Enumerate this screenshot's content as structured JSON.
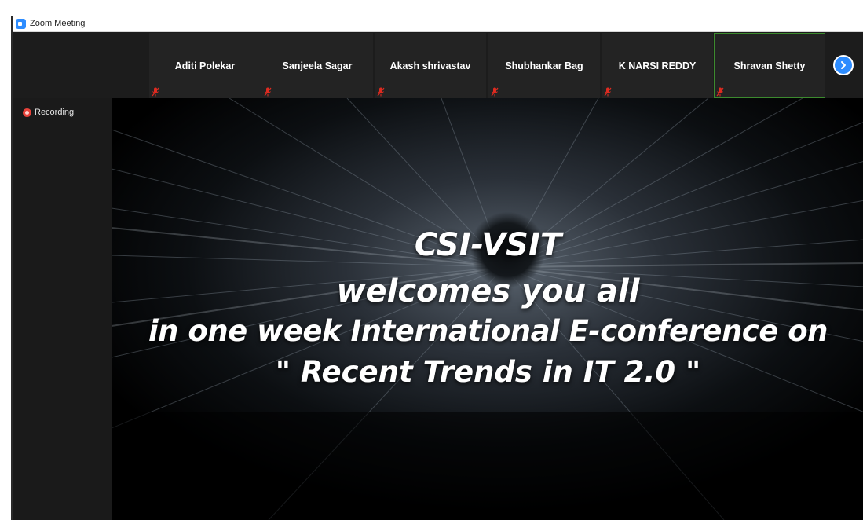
{
  "window": {
    "title": "Zoom Meeting"
  },
  "participants": [
    {
      "name": "Aditi Polekar",
      "muted": true,
      "active": false
    },
    {
      "name": "Sanjeela Sagar",
      "muted": true,
      "active": false
    },
    {
      "name": "Akash shrivastav",
      "muted": true,
      "active": false
    },
    {
      "name": "Shubhankar Bag",
      "muted": true,
      "active": false
    },
    {
      "name": "K NARSI REDDY",
      "muted": true,
      "active": false
    },
    {
      "name": "Shravan Shetty",
      "muted": true,
      "active": true
    }
  ],
  "controls": {
    "next_icon": "chevron-right-icon"
  },
  "recording": {
    "label": "Recording",
    "color": "#e8423a"
  },
  "slide": {
    "line1": "CSI-VSIT",
    "line2": "welcomes you all",
    "line3": "in one week International E-conference on",
    "line4": "\" Recent Trends in IT 2.0 \""
  },
  "colors": {
    "accent": "#2d8cff",
    "active_speaker_border": "#3c8a2e",
    "muted_mic": "#e02b20"
  }
}
